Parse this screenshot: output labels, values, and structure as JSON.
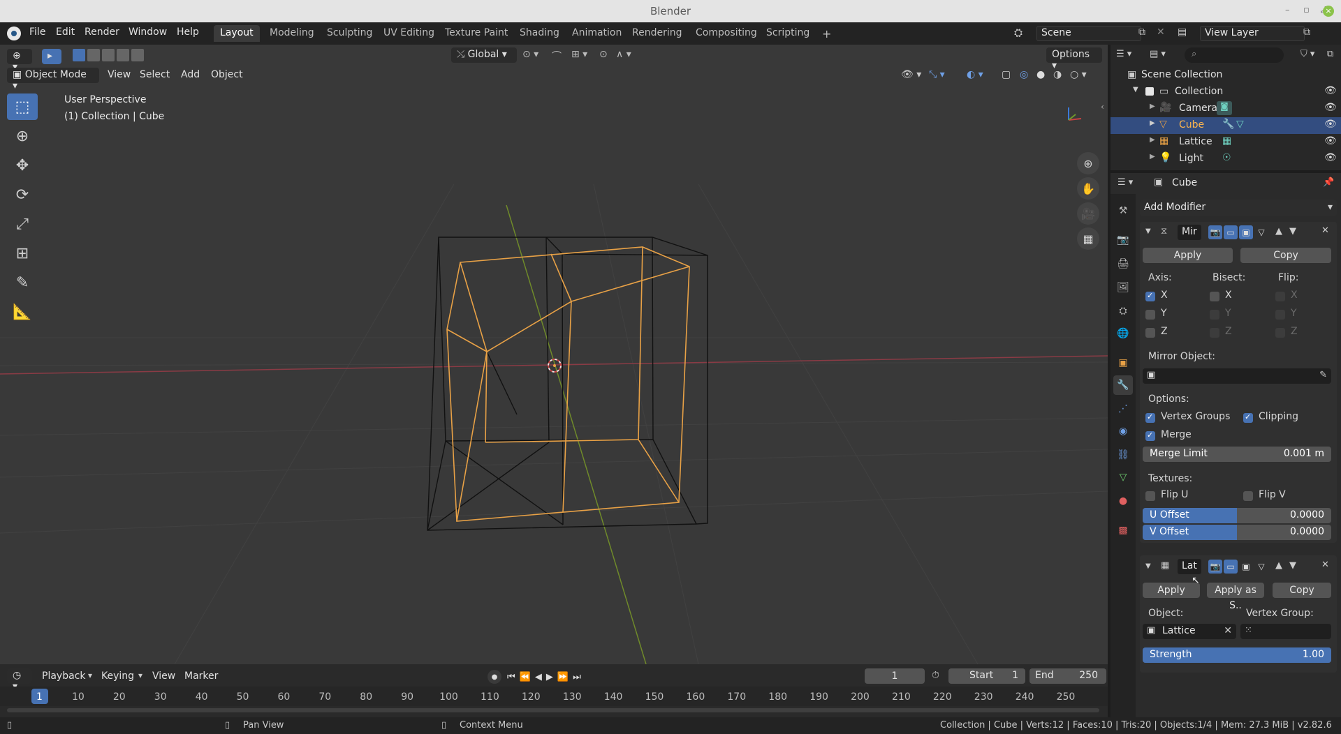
{
  "window": {
    "title": "Blender"
  },
  "menu": {
    "items": [
      "File",
      "Edit",
      "Render",
      "Window",
      "Help"
    ]
  },
  "workspaces": {
    "active": "Layout",
    "tabs": [
      "Layout",
      "Modeling",
      "Sculpting",
      "UV Editing",
      "Texture Paint",
      "Shading",
      "Animation",
      "Rendering",
      "Compositing",
      "Scripting"
    ],
    "add": "+"
  },
  "scene": {
    "name": "Scene",
    "view_layer": "View Layer"
  },
  "viewport": {
    "transform_orientation": "Global",
    "options_label": "Options",
    "mode": "Object Mode",
    "menus": [
      "View",
      "Select",
      "Add",
      "Object"
    ],
    "overlay_title": "User Perspective",
    "overlay_subtitle": "(1) Collection | Cube"
  },
  "outliner": {
    "root": "Scene Collection",
    "collection": "Collection",
    "objects": [
      {
        "name": "Camera",
        "selected": false,
        "color": "#e8a146"
      },
      {
        "name": "Cube",
        "selected": true,
        "color": "#e8a146"
      },
      {
        "name": "Lattice",
        "selected": false,
        "color": "#e8a146"
      },
      {
        "name": "Light",
        "selected": false,
        "color": "#e8a146"
      }
    ]
  },
  "properties": {
    "object_name": "Cube",
    "add_modifier": "Add Modifier",
    "mirror": {
      "name": "Mir",
      "apply": "Apply",
      "copy": "Copy",
      "axis_label": "Axis:",
      "bisect_label": "Bisect:",
      "flip_label": "Flip:",
      "axes": [
        "X",
        "Y",
        "Z"
      ],
      "mirror_object_label": "Mirror Object:",
      "options_label": "Options:",
      "vertex_groups": "Vertex Groups",
      "clipping": "Clipping",
      "merge": "Merge",
      "merge_limit_label": "Merge Limit",
      "merge_limit_value": "0.001 m",
      "textures_label": "Textures:",
      "flip_u": "Flip U",
      "flip_v": "Flip V",
      "u_offset_label": "U Offset",
      "u_offset_value": "0.0000",
      "v_offset_label": "V Offset",
      "v_offset_value": "0.0000"
    },
    "lattice": {
      "name": "Lat",
      "apply": "Apply",
      "apply_as": "Apply as S..",
      "copy": "Copy",
      "object_label": "Object:",
      "object_value": "Lattice",
      "vertex_group_label": "Vertex Group:",
      "strength_label": "Strength",
      "strength_value": "1.00"
    }
  },
  "timeline": {
    "menus": [
      "Playback",
      "Keying",
      "View",
      "Marker"
    ],
    "current_frame": "1",
    "start_label": "Start",
    "start_value": "1",
    "end_label": "End",
    "end_value": "250",
    "ticks": [
      "1",
      "10",
      "20",
      "30",
      "40",
      "50",
      "60",
      "70",
      "80",
      "90",
      "100",
      "110",
      "120",
      "130",
      "140",
      "150",
      "160",
      "170",
      "180",
      "190",
      "200",
      "210",
      "220",
      "230",
      "240",
      "250"
    ]
  },
  "status": {
    "pan_view": "Pan View",
    "context_menu": "Context Menu",
    "info": "Collection | Cube | Verts:12 | Faces:10 | Tris:20 | Objects:1/4 | Mem: 27.3 MiB | v2.82.6"
  },
  "colors": {
    "accent": "#4772b3",
    "selection": "#e8a146",
    "viewport_bg": "#393939"
  }
}
